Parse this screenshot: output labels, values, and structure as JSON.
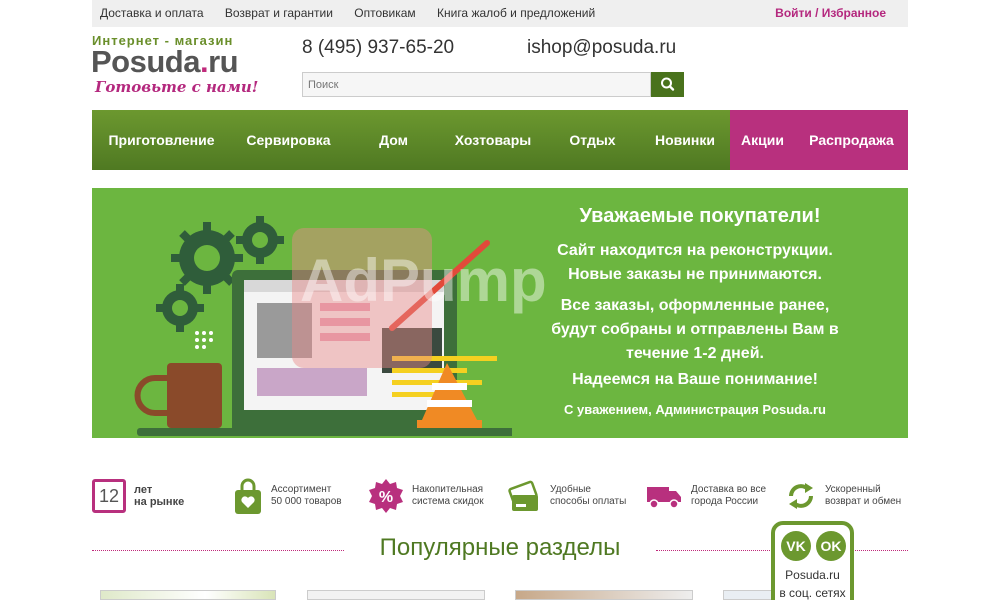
{
  "topbar": {
    "links": [
      "Доставка и оплата",
      "Возврат и гарантии",
      "Оптовикам",
      "Книга жалоб и предложений"
    ],
    "login": "Войти / Избранное"
  },
  "header": {
    "logo_top": "Интернет - магазин",
    "logo_name": "Posuda",
    "logo_dot": ".",
    "logo_tld": "ru",
    "logo_tagline": "Готовьте с нами!",
    "phone": "8 (495) 937-65-20",
    "email": "ishop@posuda.ru",
    "search_placeholder": "Поиск"
  },
  "nav": [
    "Приготовление",
    "Сервировка",
    "Дом",
    "Хозтовары",
    "Отдых",
    "Новинки",
    "Акции",
    "Распродажа"
  ],
  "banner": {
    "title": "Уважаемые покупатели!",
    "line1": "Сайт находится на реконструкции.",
    "line2": "Новые заказы не принимаются.",
    "line3": "Все заказы, оформленные ранее,",
    "line4": "будут собраны и отправлены Вам в",
    "line5": "течение 1-2 дней.",
    "line6": "Надеемся на Ваше понимание!",
    "signature": "С уважением, Администрация Posuda.ru",
    "watermark": "AdPump"
  },
  "features": {
    "years_number": "12",
    "years_l1": "лет",
    "years_l2": "на рынке",
    "assort_l1": "Ассортимент",
    "assort_l2": "50 000 товаров",
    "disc_l1": "Накопительная",
    "disc_l2": "система скидок",
    "pay_l1": "Удобные",
    "pay_l2": "способы оплаты",
    "deliv_l1": "Доставка во все",
    "deliv_l2": "города России",
    "ret_l1": "Ускоренный",
    "ret_l2": "возврат и обмен"
  },
  "popular_title": "Популярные разделы",
  "social": {
    "vk": "VK",
    "ok": "OK",
    "site": "Posuda.ru",
    "caption": "в соц. сетях"
  },
  "colors": {
    "green": "#6cb640",
    "dark_green": "#4f7922",
    "pink": "#b8307e"
  }
}
